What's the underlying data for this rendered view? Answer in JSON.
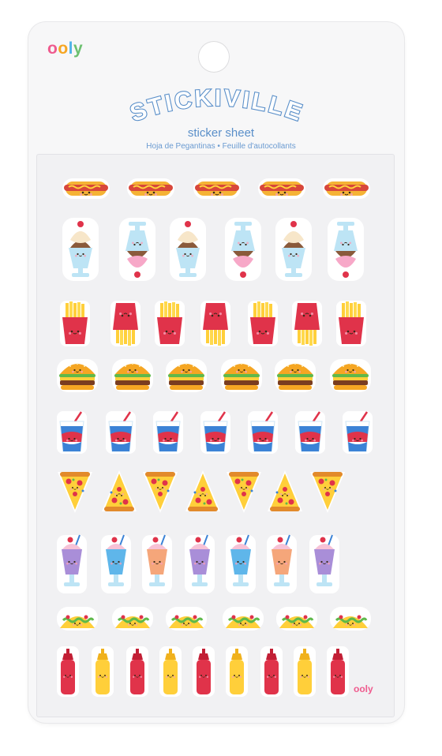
{
  "brand": {
    "letters": [
      "o",
      "o",
      "l",
      "y"
    ],
    "small_mark": "ooly"
  },
  "product": {
    "title": "STICKIVILLE",
    "subtitle": "sticker sheet",
    "tagline": "Hoja de Pegantinas • Feuille d'autocollants"
  },
  "sticker_rows": [
    {
      "name": "hotdog",
      "count": 5
    },
    {
      "name": "sundae",
      "count": 6
    },
    {
      "name": "fries",
      "count": 7
    },
    {
      "name": "burger",
      "count": 6
    },
    {
      "name": "soda",
      "count": 7
    },
    {
      "name": "pizza",
      "count": 7
    },
    {
      "name": "milkshake",
      "count": 7
    },
    {
      "name": "taco",
      "count": 6
    },
    {
      "name": "condiment",
      "count": 9
    }
  ],
  "colors": {
    "brand_pink": "#ef5b8e",
    "title_blue": "#6b9bd1"
  }
}
